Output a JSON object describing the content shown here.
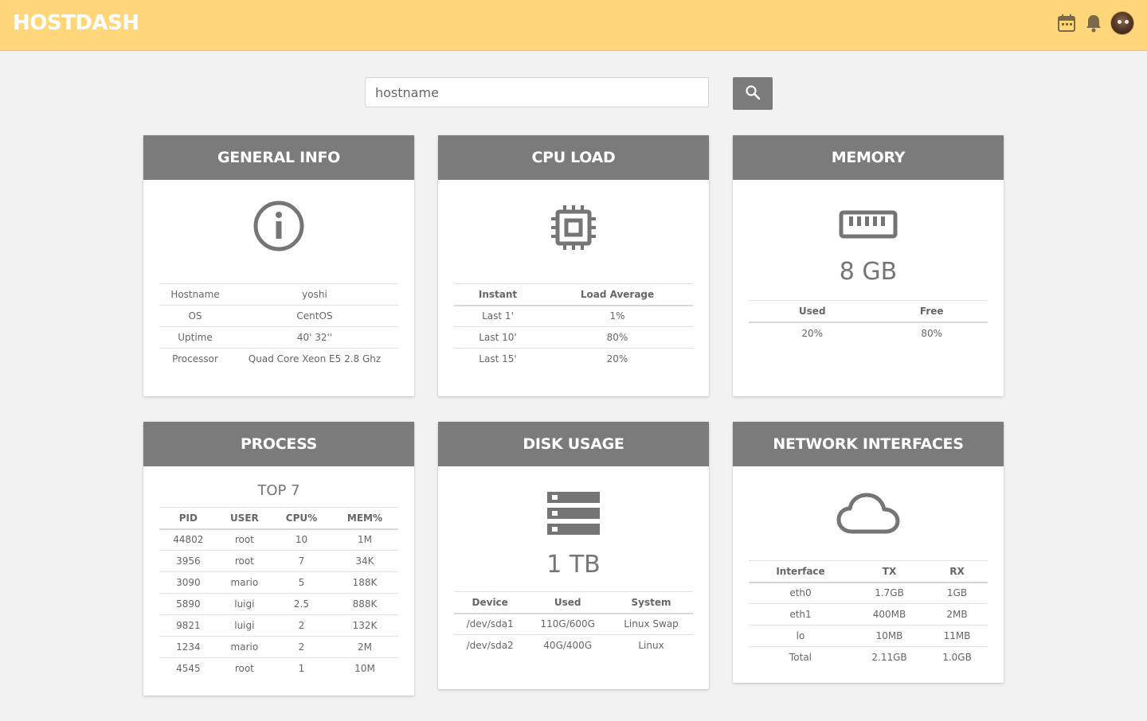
{
  "app": {
    "brand": "HOSTDASH"
  },
  "topbar": {
    "icons": [
      "calendar-icon",
      "bell-icon"
    ],
    "accent": "#ffd77a"
  },
  "search": {
    "placeholder": "hostname",
    "value": ""
  },
  "cards": {
    "general": {
      "title": "GENERAL INFO",
      "rows": [
        {
          "label": "Hostname",
          "value": "yoshi"
        },
        {
          "label": "OS",
          "value": "CentOS"
        },
        {
          "label": "Uptime",
          "value": "40' 32''"
        },
        {
          "label": "Processor",
          "value": "Quad Core Xeon E5 2.8 Ghz"
        }
      ]
    },
    "cpu": {
      "title": "CPU LOAD",
      "headers": [
        "Instant",
        "Load Average"
      ],
      "rows": [
        {
          "instant": "Last 1'",
          "load": "1%"
        },
        {
          "instant": "Last 10'",
          "load": "80%"
        },
        {
          "instant": "Last 15'",
          "load": "20%"
        }
      ]
    },
    "memory": {
      "title": "MEMORY",
      "total": "8 GB",
      "headers": [
        "Used",
        "Free"
      ],
      "used": "20%",
      "free": "80%"
    },
    "process": {
      "title": "PROCESS",
      "subtitle": "TOP 7",
      "headers": [
        "PID",
        "USER",
        "CPU%",
        "MEM%"
      ],
      "rows": [
        [
          "44802",
          "root",
          "10",
          "1M"
        ],
        [
          "3956",
          "root",
          "7",
          "34K"
        ],
        [
          "3090",
          "mario",
          "5",
          "188K"
        ],
        [
          "5890",
          "luigi",
          "2.5",
          "888K"
        ],
        [
          "9821",
          "luigi",
          "2",
          "132K"
        ],
        [
          "1234",
          "mario",
          "2",
          "2M"
        ],
        [
          "4545",
          "root",
          "1",
          "10M"
        ]
      ]
    },
    "disk": {
      "title": "DISK USAGE",
      "total": "1 TB",
      "headers": [
        "Device",
        "Used",
        "System"
      ],
      "rows": [
        [
          "/dev/sda1",
          "110G/600G",
          "Linux Swap"
        ],
        [
          "/dev/sda2",
          "40G/400G",
          "Linux"
        ]
      ]
    },
    "network": {
      "title": "NETWORK INTERFACES",
      "headers": [
        "Interface",
        "TX",
        "RX"
      ],
      "rows": [
        [
          "eth0",
          "1.7GB",
          "1GB"
        ],
        [
          "eth1",
          "400MB",
          "2MB"
        ],
        [
          "lo",
          "10MB",
          "11MB"
        ],
        [
          "Total",
          "2.11GB",
          "1.0GB"
        ]
      ]
    }
  }
}
